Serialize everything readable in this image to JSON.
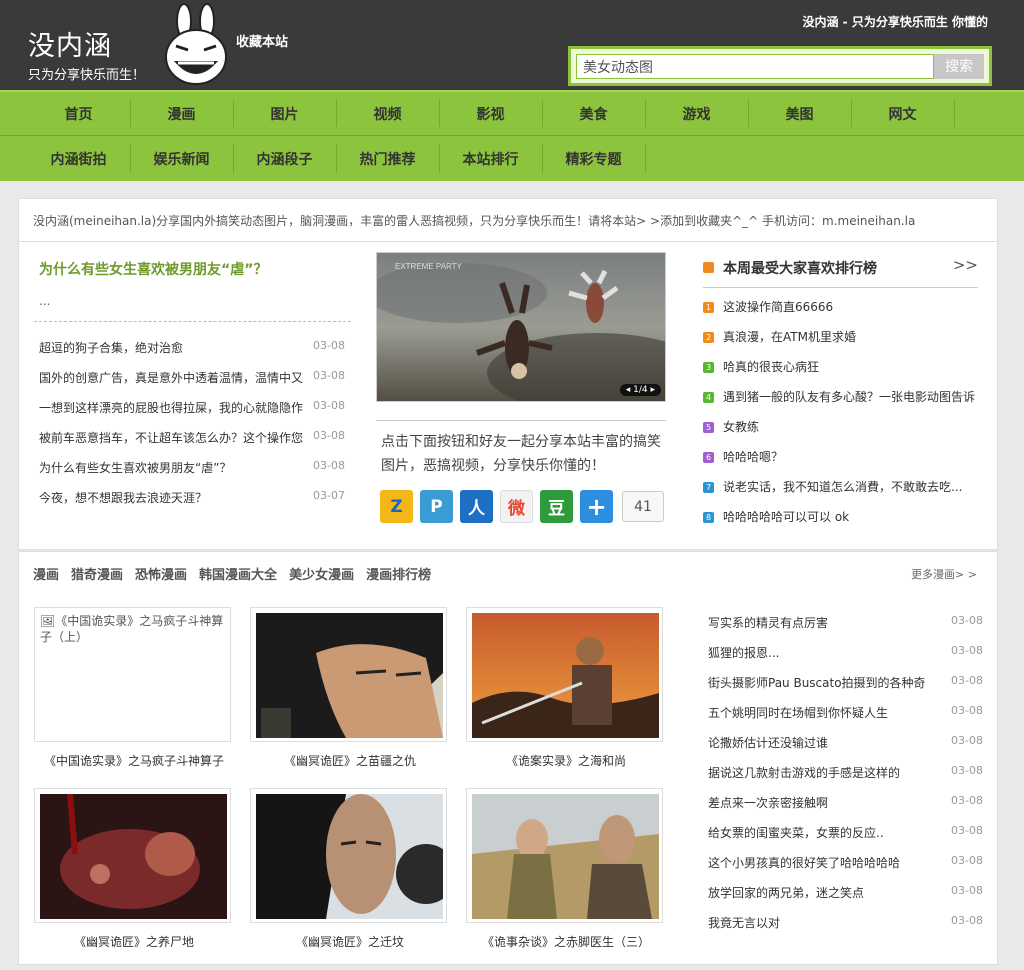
{
  "header": {
    "logo_title": "没内涵",
    "logo_sub": "只为分享快乐而生！",
    "favorite": "收藏本站",
    "slogan": "没内涵 - 只为分享快乐而生 你懂的",
    "search_value": "美女动态图",
    "search_button": "搜索"
  },
  "nav_primary": [
    "首页",
    "漫画",
    "图片",
    "视频",
    "影视",
    "美食",
    "游戏",
    "美图",
    "网文"
  ],
  "nav_secondary": [
    "内涵街拍",
    "娱乐新闻",
    "内涵段子",
    "热门推荐",
    "本站排行",
    "精彩专题"
  ],
  "notice": "没内涵(meineihan.la)分享国内外搞笑动态图片，脑洞漫画，丰富的雷人恶搞视频，只为分享快乐而生！请将本站> >添加到收藏夹^_^ 手机访问：m.meineihan.la",
  "featured": {
    "title": "为什么有些女生喜欢被男朋友“虐”？",
    "excerpt": "..."
  },
  "news": [
    {
      "title": "超逗的狗子合集，绝对治愈",
      "date": "03-08"
    },
    {
      "title": "国外的创意广告，真是意外中透着温情，温情中又",
      "date": "03-08"
    },
    {
      "title": "一想到这样漂亮的屁股也得拉屎，我的心就隐隐作",
      "date": "03-08"
    },
    {
      "title": "被前车恶意挡车，不让超车该怎么办？这个操作您",
      "date": "03-08"
    },
    {
      "title": "为什么有些女生喜欢被男朋友“虐”？",
      "date": "03-08"
    },
    {
      "title": "今夜，想不想跟我去浪迹天涯？",
      "date": "03-07"
    }
  ],
  "slider": {
    "counter": "1/4",
    "watermark": "EXTREME PARTY"
  },
  "share": {
    "text": "点击下面按钮和好友一起分享本站丰富的搞笑图片，恶搞视频，分享快乐你懂的！",
    "count": "41",
    "icons": [
      {
        "icon": "qzone-icon",
        "glyph": "Z",
        "color": "#f0b000"
      },
      {
        "icon": "tencent-weibo-icon",
        "glyph": "P",
        "color": "#3b9bd4"
      },
      {
        "icon": "renren-icon",
        "glyph": "人",
        "color": "#1d6fc3"
      },
      {
        "icon": "sina-weibo-icon",
        "glyph": "微",
        "color": "#e6492f"
      },
      {
        "icon": "douban-icon",
        "glyph": "豆",
        "color": "#2f9a3c"
      },
      {
        "icon": "more-share-icon",
        "glyph": "+",
        "color": "#2d8ee0"
      }
    ]
  },
  "ranking": {
    "title": "本周最受大家喜欢排行榜",
    "more": ">>",
    "items": [
      {
        "num": "1",
        "color": "#f08a1d",
        "title": "这波操作简直66666"
      },
      {
        "num": "2",
        "color": "#f08a1d",
        "title": "真浪漫，在ATM机里求婚"
      },
      {
        "num": "3",
        "color": "#5ab531",
        "title": "哈真的很丧心病狂"
      },
      {
        "num": "4",
        "color": "#5ab531",
        "title": "遇到猪一般的队友有多心酸？一张电影动图告诉"
      },
      {
        "num": "5",
        "color": "#a05fcf",
        "title": "女教练"
      },
      {
        "num": "6",
        "color": "#a05fcf",
        "title": "哈哈哈嗯？"
      },
      {
        "num": "7",
        "color": "#2a95d3",
        "title": "说老实话，我不知道怎么消費，不敢敢去吃..."
      },
      {
        "num": "8",
        "color": "#2a95d3",
        "title": "哈哈哈哈哈可以可以 ok"
      }
    ]
  },
  "comics": {
    "tabs": [
      "漫画",
      "猎奇漫画",
      "恐怖漫画",
      "韩国漫画大全",
      "美少女漫画",
      "漫画排行榜"
    ],
    "more": "更多漫画> >",
    "items": [
      {
        "caption": "《中国诡实录》之马疯子斗神算子",
        "alt": "《中国诡实录》之马疯子斗神算子（上）"
      },
      {
        "caption": "《幽冥诡匠》之苗疆之仇"
      },
      {
        "caption": "《诡案实录》之海和尚"
      },
      {
        "caption": "《幽冥诡匠》之养尸地"
      },
      {
        "caption": "《幽冥诡匠》之迁坟"
      },
      {
        "caption": "《诡事杂谈》之赤脚医生（三）"
      }
    ],
    "side_list": [
      {
        "title": "写实系的精灵有点厉害",
        "date": "03-08"
      },
      {
        "title": "狐狸的报恩...",
        "date": "03-08"
      },
      {
        "title": "街头摄影师Pau Buscato拍摄到的各种奇",
        "date": "03-08"
      },
      {
        "title": "五个姚明同时在场帽到你怀疑人生",
        "date": "03-08"
      },
      {
        "title": "论撒娇估计还没输过谁",
        "date": "03-08"
      },
      {
        "title": "据说这几款射击游戏的手感是这样的",
        "date": "03-08"
      },
      {
        "title": "差点来一次亲密接触啊",
        "date": "03-08"
      },
      {
        "title": "给女票的闺蜜夹菜，女票的反应..",
        "date": "03-08"
      },
      {
        "title": "这个小男孩真的很好笑了哈哈哈哈哈",
        "date": "03-08"
      },
      {
        "title": "放学回家的两兄弟，迷之笑点",
        "date": "03-08"
      },
      {
        "title": "我竟无言以对",
        "date": "03-08"
      }
    ]
  }
}
